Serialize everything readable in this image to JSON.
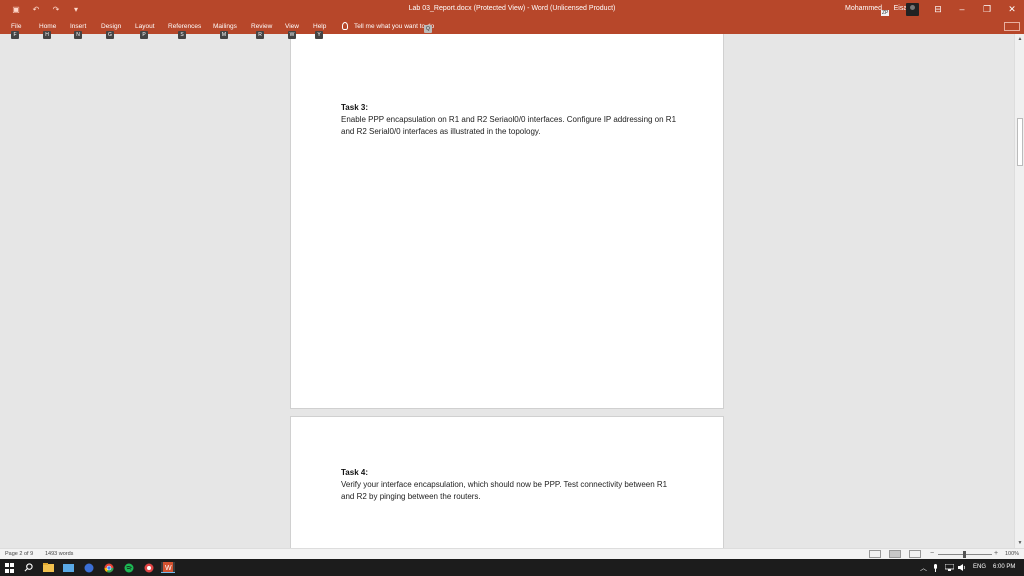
{
  "window": {
    "title": "Lab 03_Report.docx (Protected View)  -  Word (Unlicensed Product)",
    "user_name": "Mohammed",
    "user_name_suffix": "Eisa",
    "user_initials": "ZP"
  },
  "ribbon": {
    "tabs": [
      {
        "label": "File",
        "keytip": "F"
      },
      {
        "label": "Home",
        "keytip": "H"
      },
      {
        "label": "Insert",
        "keytip": "N"
      },
      {
        "label": "Design",
        "keytip": "G"
      },
      {
        "label": "Layout",
        "keytip": "P"
      },
      {
        "label": "References",
        "keytip": "S"
      },
      {
        "label": "Mailings",
        "keytip": "M"
      },
      {
        "label": "Review",
        "keytip": "R"
      },
      {
        "label": "View",
        "keytip": "W"
      },
      {
        "label": "Help",
        "keytip": "Y"
      }
    ],
    "tell_me": "Tell me what you want to do",
    "tell_me_keytip": "Q"
  },
  "document": {
    "task3": {
      "title": "Task 3:",
      "body": "Enable PPP encapsulation on R1 and R2 Seriaol0/0 interfaces. Configure IP addressing on R1 and R2 Serial0/0 interfaces as illustrated in the topology."
    },
    "task4": {
      "title": "Task 4:",
      "body": "Verify your interface encapsulation, which should now be PPP. Test connectivity between R1 and R2 by pinging between the routers."
    }
  },
  "status": {
    "page": "Page 2 of 9",
    "words": "1493 words",
    "zoom": "100%"
  },
  "taskbar": {
    "language": "ENG",
    "time": "6:00 PM"
  },
  "icons": {
    "start": "windows-logo",
    "search": "search-icon",
    "word": "word-icon"
  },
  "colors": {
    "word_accent": "#b7472a",
    "taskbar": "#1c1c1c"
  }
}
